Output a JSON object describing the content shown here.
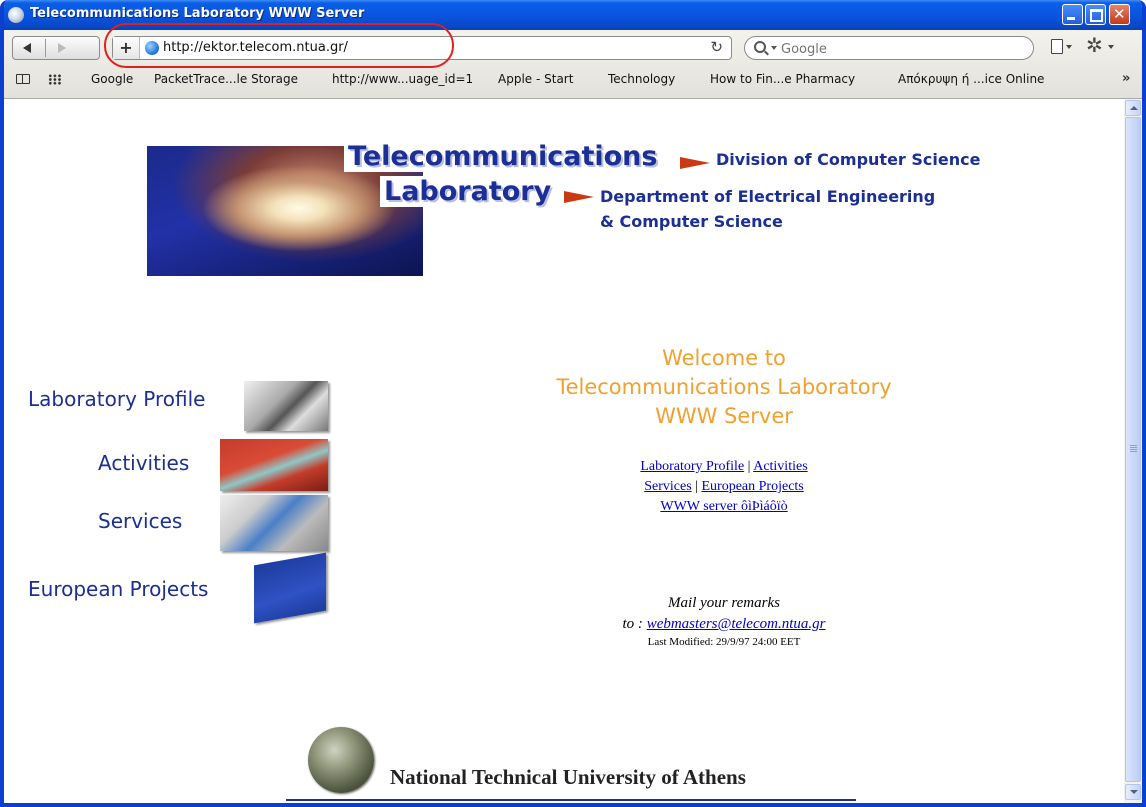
{
  "window": {
    "title": "Telecommunications Laboratory WWW Server"
  },
  "toolbar": {
    "url": "http://ektor.telecom.ntua.gr/",
    "search_placeholder": "Google",
    "reload_glyph": "↻"
  },
  "bookmarks": [
    "Google",
    "PacketTrace...le Storage",
    "http://www...uage_id=1",
    "Apple - Start",
    "Technology",
    "How to Fin...e Pharmacy",
    "Απόκρυψη ή ...ice Online"
  ],
  "bookmarks_more": "»",
  "page": {
    "banner": {
      "title_line1": "Telecommunications",
      "title_line2": "Laboratory",
      "division": "Division of Computer Science",
      "department_line1": "Department of Electrical Engineering",
      "department_line2": "& Computer Science"
    },
    "nav": [
      {
        "label": "Laboratory Profile"
      },
      {
        "label": "Activities"
      },
      {
        "label": "Services"
      },
      {
        "label": "European Projects"
      }
    ],
    "welcome": {
      "line1": "Welcome to",
      "line2": "Telecommunications Laboratory",
      "line3": "WWW Server"
    },
    "links": {
      "lab_profile": "Laboratory Profile",
      "activities": "Activities",
      "services": "Services",
      "european_projects": "European Projects",
      "www_server": "WWW server ôìÞìáôïò",
      "separator": "|"
    },
    "mail": {
      "line1": "Mail your remarks",
      "prefix": "to : ",
      "address": "webmasters@telecom.ntua.gr"
    },
    "last_modified": "Last Modified: 29/9/97 24:00 EET",
    "footer": {
      "university": "National Technical University of Athens"
    }
  },
  "colors": {
    "brand_blue": "#1b2f94",
    "welcome_orange": "#f2a02f",
    "link_blue": "#0000cc",
    "arrow_red": "#c93a14",
    "highlight_red": "#e02020"
  }
}
